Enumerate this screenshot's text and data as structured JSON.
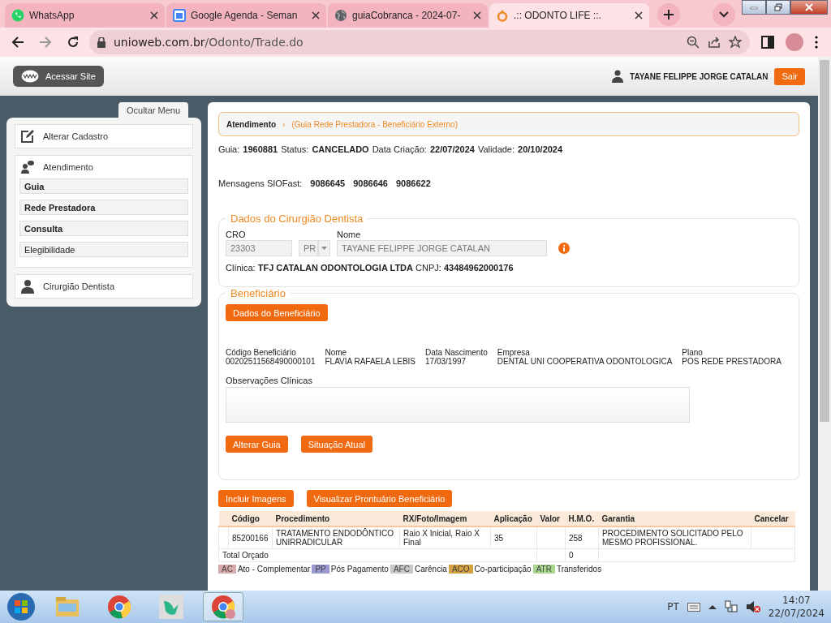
{
  "browser": {
    "tabs": [
      {
        "title": "WhatsApp",
        "kind": "whatsapp",
        "selected": false
      },
      {
        "title": "Google Agenda - Seman",
        "kind": "calendar",
        "selected": false
      },
      {
        "title": "guiaCobranca - 2024-07-",
        "kind": "globe",
        "selected": false
      },
      {
        "title": ".:: ODONTO LIFE ::.",
        "kind": "ring",
        "selected": true
      }
    ],
    "url_host": "unioweb.com.br",
    "url_path": "/Odonto/Trade.do"
  },
  "header": {
    "site_button": "Acessar Site",
    "user": "TAYANE FELIPPE JORGE CATALAN",
    "logout": "Sair"
  },
  "sidebar": {
    "toggle": "Ocultar Menu",
    "sections": [
      {
        "label": "Alterar Cadastro",
        "kind": "edit"
      },
      {
        "label": "Atendimento",
        "kind": "chat",
        "children": [
          {
            "label": "Guia",
            "bold": true
          },
          {
            "label": "Rede Prestadora",
            "bold": true
          },
          {
            "label": "Consulta",
            "bold": true
          },
          {
            "label": "Elegibilidade",
            "bold": false
          }
        ]
      },
      {
        "label": "Cirurgião Dentista",
        "kind": "person"
      }
    ]
  },
  "breadcrumb": {
    "section": "Atendimento",
    "separator": "›",
    "path": "(Guia Rede Prestadora - Beneficiário Externo)"
  },
  "summary": [
    {
      "label": "Guia:",
      "value": "1960881"
    },
    {
      "label": "Status:",
      "value": "CANCELADO"
    },
    {
      "label": "Data Criação:",
      "value": "22/07/2024"
    },
    {
      "label": "Validade:",
      "value": "20/10/2024"
    }
  ],
  "messages": {
    "label": "Mensagens SIOFast:",
    "codes": [
      "9086645",
      "9086646",
      "9086622"
    ]
  },
  "dentist": {
    "title": "Dados do Cirurgião Dentista",
    "cro_label": "CRO",
    "cro": "23303",
    "uf": "PR",
    "name_label": "Nome",
    "name": "TAYANE FELIPPE JORGE CATALAN",
    "clinic_label": "Clínica:",
    "clinic": "TFJ CATALAN ODONTOLOGIA LTDA",
    "cnpj_label": "CNPJ:",
    "cnpj": "43484962000176"
  },
  "beneficiary": {
    "title": "Beneficiário",
    "button": "Dados do Beneficiário",
    "fields": [
      {
        "label": "Código Beneficiário",
        "value": "00202511568490000101"
      },
      {
        "label": "Nome",
        "value": "FLAVIA RAFAELA LEBIS"
      },
      {
        "label": "Data Nascimento",
        "value": "17/03/1997"
      },
      {
        "label": "Empresa",
        "value": "DENTAL UNI COOPERATIVA ODONTOLOGICA"
      },
      {
        "label": "Plano",
        "value": "POS REDE PRESTADORA"
      }
    ],
    "notes_label": "Observações Clínicas",
    "buttons": [
      "Alterar Guia",
      "Situação Atual"
    ]
  },
  "actions": [
    "Incluir Imagens",
    "Visualizar Prontuário Beneficiário"
  ],
  "table": {
    "columns": [
      "Código",
      "Procedimento",
      "RX/Foto/Imagem",
      "Aplicação",
      "Valor",
      "H.M.O.",
      "Garantia",
      "Cancelar"
    ],
    "rows": [
      [
        "85200166",
        "TRATAMENTO ENDODÔNTICO UNIRRADICULAR",
        "Raio X Inicial, Raio X Final",
        "35",
        "",
        "258",
        "PROCEDIMENTO SOLICITADO PELO MESMO PROFISSIONAL.",
        ""
      ]
    ],
    "total": {
      "label": "Total Orçado",
      "hmo": "0"
    }
  },
  "legend": [
    {
      "code": "AC",
      "label": "Ato - Complementar",
      "color": "#d8aaaa"
    },
    {
      "code": "PP",
      "label": "Pós Pagamento",
      "color": "#9a9ad0"
    },
    {
      "code": "AFC",
      "label": "Carência",
      "color": "#c8c8c8"
    },
    {
      "code": "ACO",
      "label": "Co-participação",
      "color": "#d4a040"
    },
    {
      "code": "ATR",
      "label": "Transferidos",
      "color": "#a8d890"
    }
  ],
  "taskbar": {
    "language": "PT",
    "time": "14:07",
    "date": "22/07/2024"
  }
}
